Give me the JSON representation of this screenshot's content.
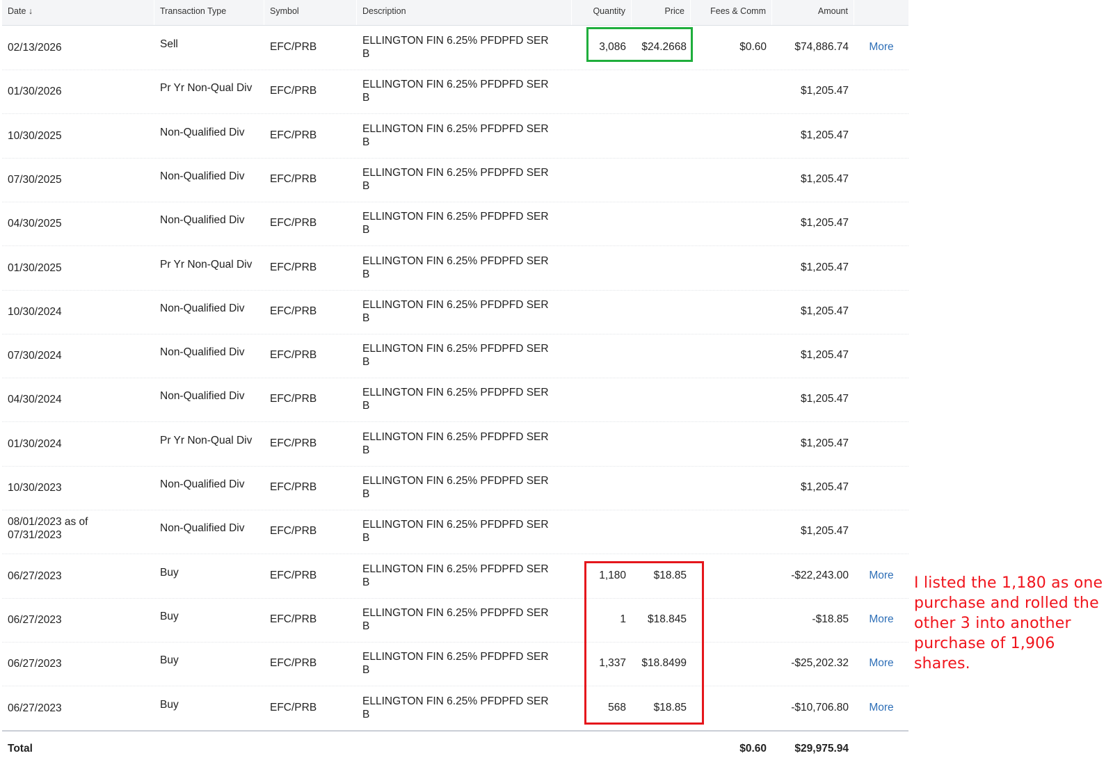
{
  "table": {
    "headers": {
      "date": "Date",
      "sort_arrow": "↓",
      "type": "Transaction Type",
      "symbol": "Symbol",
      "description": "Description",
      "quantity": "Quantity",
      "price": "Price",
      "fees": "Fees & Comm",
      "amount": "Amount"
    },
    "rows": [
      {
        "date": "02/13/2026",
        "type": "Sell",
        "symbol": "EFC/PRB",
        "desc1": "ELLINGTON FIN 6.25% PFDPFD SER",
        "desc2": "B",
        "qty": "3,086",
        "price": "$24.2668",
        "fees": "$0.60",
        "amount": "$74,886.74",
        "more": "More"
      },
      {
        "date": "01/30/2026",
        "type": "Pr Yr Non-Qual Div",
        "symbol": "EFC/PRB",
        "desc1": "ELLINGTON FIN 6.25% PFDPFD SER",
        "desc2": "B",
        "qty": "",
        "price": "",
        "fees": "",
        "amount": "$1,205.47",
        "more": ""
      },
      {
        "date": "10/30/2025",
        "type": "Non-Qualified Div",
        "symbol": "EFC/PRB",
        "desc1": "ELLINGTON FIN 6.25% PFDPFD SER",
        "desc2": "B",
        "qty": "",
        "price": "",
        "fees": "",
        "amount": "$1,205.47",
        "more": ""
      },
      {
        "date": "07/30/2025",
        "type": "Non-Qualified Div",
        "symbol": "EFC/PRB",
        "desc1": "ELLINGTON FIN 6.25% PFDPFD SER",
        "desc2": "B",
        "qty": "",
        "price": "",
        "fees": "",
        "amount": "$1,205.47",
        "more": ""
      },
      {
        "date": "04/30/2025",
        "type": "Non-Qualified Div",
        "symbol": "EFC/PRB",
        "desc1": "ELLINGTON FIN 6.25% PFDPFD SER",
        "desc2": "B",
        "qty": "",
        "price": "",
        "fees": "",
        "amount": "$1,205.47",
        "more": ""
      },
      {
        "date": "01/30/2025",
        "type": "Pr Yr Non-Qual Div",
        "symbol": "EFC/PRB",
        "desc1": "ELLINGTON FIN 6.25% PFDPFD SER",
        "desc2": "B",
        "qty": "",
        "price": "",
        "fees": "",
        "amount": "$1,205.47",
        "more": ""
      },
      {
        "date": "10/30/2024",
        "type": "Non-Qualified Div",
        "symbol": "EFC/PRB",
        "desc1": "ELLINGTON FIN 6.25% PFDPFD SER",
        "desc2": "B",
        "qty": "",
        "price": "",
        "fees": "",
        "amount": "$1,205.47",
        "more": ""
      },
      {
        "date": "07/30/2024",
        "type": "Non-Qualified Div",
        "symbol": "EFC/PRB",
        "desc1": "ELLINGTON FIN 6.25% PFDPFD SER",
        "desc2": "B",
        "qty": "",
        "price": "",
        "fees": "",
        "amount": "$1,205.47",
        "more": ""
      },
      {
        "date": "04/30/2024",
        "type": "Non-Qualified Div",
        "symbol": "EFC/PRB",
        "desc1": "ELLINGTON FIN 6.25% PFDPFD SER",
        "desc2": "B",
        "qty": "",
        "price": "",
        "fees": "",
        "amount": "$1,205.47",
        "more": ""
      },
      {
        "date": "01/30/2024",
        "type": "Pr Yr Non-Qual Div",
        "symbol": "EFC/PRB",
        "desc1": "ELLINGTON FIN 6.25% PFDPFD SER",
        "desc2": "B",
        "qty": "",
        "price": "",
        "fees": "",
        "amount": "$1,205.47",
        "more": ""
      },
      {
        "date": "10/30/2023",
        "type": "Non-Qualified Div",
        "symbol": "EFC/PRB",
        "desc1": "ELLINGTON FIN 6.25% PFDPFD SER",
        "desc2": "B",
        "qty": "",
        "price": "",
        "fees": "",
        "amount": "$1,205.47",
        "more": ""
      },
      {
        "date": "08/01/2023 as of",
        "date2": "07/31/2023",
        "type": "Non-Qualified Div",
        "symbol": "EFC/PRB",
        "desc1": "ELLINGTON FIN 6.25% PFDPFD SER",
        "desc2": "B",
        "qty": "",
        "price": "",
        "fees": "",
        "amount": "$1,205.47",
        "more": ""
      },
      {
        "date": "06/27/2023",
        "type": "Buy",
        "symbol": "EFC/PRB",
        "desc1": "ELLINGTON FIN 6.25% PFDPFD SER",
        "desc2": "B",
        "qty": "1,180",
        "price": "$18.85",
        "fees": "",
        "amount": "-$22,243.00",
        "more": "More"
      },
      {
        "date": "06/27/2023",
        "type": "Buy",
        "symbol": "EFC/PRB",
        "desc1": "ELLINGTON FIN 6.25% PFDPFD SER",
        "desc2": "B",
        "qty": "1",
        "price": "$18.845",
        "fees": "",
        "amount": "-$18.85",
        "more": "More"
      },
      {
        "date": "06/27/2023",
        "type": "Buy",
        "symbol": "EFC/PRB",
        "desc1": "ELLINGTON FIN 6.25% PFDPFD SER",
        "desc2": "B",
        "qty": "1,337",
        "price": "$18.8499",
        "fees": "",
        "amount": "-$25,202.32",
        "more": "More"
      },
      {
        "date": "06/27/2023",
        "type": "Buy",
        "symbol": "EFC/PRB",
        "desc1": "ELLINGTON FIN 6.25% PFDPFD SER",
        "desc2": "B",
        "qty": "568",
        "price": "$18.85",
        "fees": "",
        "amount": "-$10,706.80",
        "more": "More"
      }
    ],
    "total": {
      "label": "Total",
      "fees": "$0.60",
      "amount": "$29,975.94"
    }
  },
  "annotation": {
    "text": "I listed the 1,180 as one purchase and rolled the other 3 into another purchase of 1,906 shares.",
    "color": "#f0141c"
  },
  "highlight_colors": {
    "green": "#1fae3c",
    "red": "#e5161c"
  },
  "link_color": "#2e6fb7"
}
